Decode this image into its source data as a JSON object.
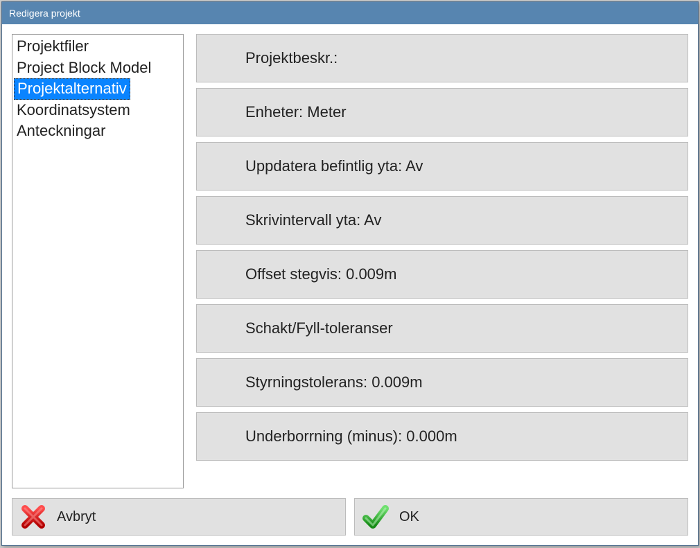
{
  "window": {
    "title": "Redigera projekt"
  },
  "sidebar": {
    "items": [
      {
        "label": "Projektfiler",
        "selected": false
      },
      {
        "label": "Project Block Model",
        "selected": false
      },
      {
        "label": "Projektalternativ",
        "selected": true
      },
      {
        "label": "Koordinatsystem",
        "selected": false
      },
      {
        "label": "Anteckningar",
        "selected": false
      }
    ]
  },
  "settings": [
    {
      "label": "Projektbeskr.:"
    },
    {
      "label": "Enheter: Meter"
    },
    {
      "label": "Uppdatera befintlig yta: Av"
    },
    {
      "label": "Skrivintervall yta: Av"
    },
    {
      "label": "Offset stegvis: 0.009m"
    },
    {
      "label": "Schakt/Fyll-toleranser"
    },
    {
      "label": "Styrningstolerans: 0.009m"
    },
    {
      "label": "Underborrning (minus): 0.000m"
    }
  ],
  "footer": {
    "cancel_label": "Avbryt",
    "ok_label": "OK"
  }
}
